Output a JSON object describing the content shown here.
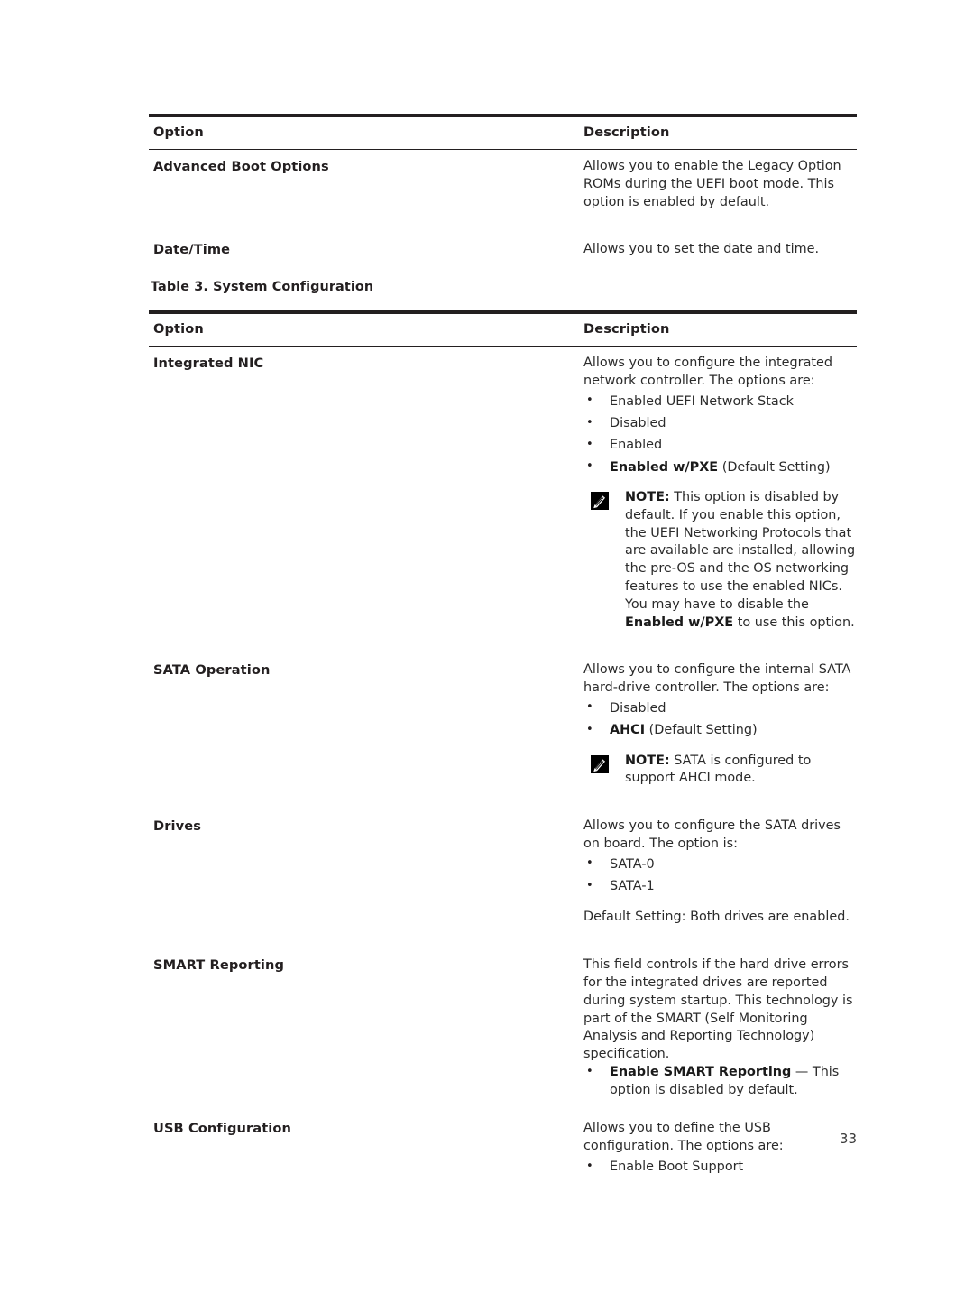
{
  "page": {
    "number": "33"
  },
  "table1": {
    "headers": {
      "option": "Option",
      "description": "Description"
    },
    "rows": [
      {
        "option": "Advanced Boot Options",
        "description": "Allows you to enable the Legacy Option ROMs during the UEFI boot mode. This option is enabled by default."
      },
      {
        "option": "Date/Time",
        "description": "Allows you to set the date and time."
      }
    ]
  },
  "table2": {
    "caption": "Table 3. System Configuration",
    "headers": {
      "option": "Option",
      "description": "Description"
    },
    "rows": {
      "integrated_nic": {
        "option": "Integrated NIC",
        "intro": "Allows you to configure the integrated network controller. The options are:",
        "bullets": [
          {
            "text": "Enabled UEFI Network Stack"
          },
          {
            "text": "Disabled"
          },
          {
            "text": "Enabled"
          },
          {
            "bold": "Enabled w/PXE",
            "text": " (Default Setting)"
          }
        ],
        "note": {
          "icon": "note-pencil-icon",
          "label": "NOTE:",
          "text": " This option is disabled by default. If you enable this option, the UEFI Networking Protocols that are available are installed, allowing the pre-OS and the OS networking features to use the enabled NICs. You may have to disable the ",
          "bold_tail": "Enabled w/PXE",
          "text_tail": " to use this option."
        }
      },
      "sata_operation": {
        "option": "SATA Operation",
        "intro": "Allows you to configure the internal SATA hard-drive controller. The options are:",
        "bullets": [
          {
            "text": "Disabled"
          },
          {
            "bold": "AHCI",
            "text": " (Default Setting)"
          }
        ],
        "note": {
          "icon": "note-pencil-icon",
          "label": "NOTE:",
          "text": " SATA is configured to support AHCI mode."
        }
      },
      "drives": {
        "option": "Drives",
        "intro": "Allows you to configure the SATA drives on board. The option is:",
        "bullets": [
          {
            "text": "SATA-0"
          },
          {
            "text": "SATA-1"
          }
        ],
        "outro": "Default Setting: Both drives are enabled."
      },
      "smart_reporting": {
        "option": "SMART Reporting",
        "intro": "This field controls if the hard drive errors for the integrated drives are reported during system startup. This technology is part of the SMART (Self Monitoring Analysis and Reporting Technology) specification.",
        "bullets": [
          {
            "bold": "Enable SMART Reporting",
            "text": " — This option is disabled by default."
          }
        ]
      },
      "usb_configuration": {
        "option": "USB Configuration",
        "intro": "Allows you to define the USB configuration. The options are:",
        "bullets": [
          {
            "text": "Enable Boot Support"
          }
        ]
      }
    }
  }
}
